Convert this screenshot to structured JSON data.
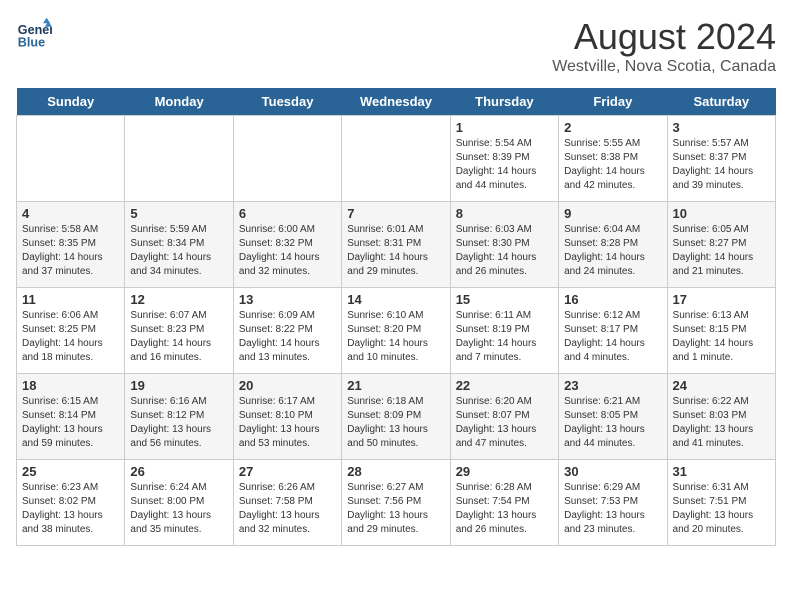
{
  "logo": {
    "line1": "General",
    "line2": "Blue"
  },
  "title": "August 2024",
  "subtitle": "Westville, Nova Scotia, Canada",
  "days_of_week": [
    "Sunday",
    "Monday",
    "Tuesday",
    "Wednesday",
    "Thursday",
    "Friday",
    "Saturday"
  ],
  "weeks": [
    [
      {
        "day": "",
        "info": ""
      },
      {
        "day": "",
        "info": ""
      },
      {
        "day": "",
        "info": ""
      },
      {
        "day": "",
        "info": ""
      },
      {
        "day": "1",
        "info": "Sunrise: 5:54 AM\nSunset: 8:39 PM\nDaylight: 14 hours and 44 minutes."
      },
      {
        "day": "2",
        "info": "Sunrise: 5:55 AM\nSunset: 8:38 PM\nDaylight: 14 hours and 42 minutes."
      },
      {
        "day": "3",
        "info": "Sunrise: 5:57 AM\nSunset: 8:37 PM\nDaylight: 14 hours and 39 minutes."
      }
    ],
    [
      {
        "day": "4",
        "info": "Sunrise: 5:58 AM\nSunset: 8:35 PM\nDaylight: 14 hours and 37 minutes."
      },
      {
        "day": "5",
        "info": "Sunrise: 5:59 AM\nSunset: 8:34 PM\nDaylight: 14 hours and 34 minutes."
      },
      {
        "day": "6",
        "info": "Sunrise: 6:00 AM\nSunset: 8:32 PM\nDaylight: 14 hours and 32 minutes."
      },
      {
        "day": "7",
        "info": "Sunrise: 6:01 AM\nSunset: 8:31 PM\nDaylight: 14 hours and 29 minutes."
      },
      {
        "day": "8",
        "info": "Sunrise: 6:03 AM\nSunset: 8:30 PM\nDaylight: 14 hours and 26 minutes."
      },
      {
        "day": "9",
        "info": "Sunrise: 6:04 AM\nSunset: 8:28 PM\nDaylight: 14 hours and 24 minutes."
      },
      {
        "day": "10",
        "info": "Sunrise: 6:05 AM\nSunset: 8:27 PM\nDaylight: 14 hours and 21 minutes."
      }
    ],
    [
      {
        "day": "11",
        "info": "Sunrise: 6:06 AM\nSunset: 8:25 PM\nDaylight: 14 hours and 18 minutes."
      },
      {
        "day": "12",
        "info": "Sunrise: 6:07 AM\nSunset: 8:23 PM\nDaylight: 14 hours and 16 minutes."
      },
      {
        "day": "13",
        "info": "Sunrise: 6:09 AM\nSunset: 8:22 PM\nDaylight: 14 hours and 13 minutes."
      },
      {
        "day": "14",
        "info": "Sunrise: 6:10 AM\nSunset: 8:20 PM\nDaylight: 14 hours and 10 minutes."
      },
      {
        "day": "15",
        "info": "Sunrise: 6:11 AM\nSunset: 8:19 PM\nDaylight: 14 hours and 7 minutes."
      },
      {
        "day": "16",
        "info": "Sunrise: 6:12 AM\nSunset: 8:17 PM\nDaylight: 14 hours and 4 minutes."
      },
      {
        "day": "17",
        "info": "Sunrise: 6:13 AM\nSunset: 8:15 PM\nDaylight: 14 hours and 1 minute."
      }
    ],
    [
      {
        "day": "18",
        "info": "Sunrise: 6:15 AM\nSunset: 8:14 PM\nDaylight: 13 hours and 59 minutes."
      },
      {
        "day": "19",
        "info": "Sunrise: 6:16 AM\nSunset: 8:12 PM\nDaylight: 13 hours and 56 minutes."
      },
      {
        "day": "20",
        "info": "Sunrise: 6:17 AM\nSunset: 8:10 PM\nDaylight: 13 hours and 53 minutes."
      },
      {
        "day": "21",
        "info": "Sunrise: 6:18 AM\nSunset: 8:09 PM\nDaylight: 13 hours and 50 minutes."
      },
      {
        "day": "22",
        "info": "Sunrise: 6:20 AM\nSunset: 8:07 PM\nDaylight: 13 hours and 47 minutes."
      },
      {
        "day": "23",
        "info": "Sunrise: 6:21 AM\nSunset: 8:05 PM\nDaylight: 13 hours and 44 minutes."
      },
      {
        "day": "24",
        "info": "Sunrise: 6:22 AM\nSunset: 8:03 PM\nDaylight: 13 hours and 41 minutes."
      }
    ],
    [
      {
        "day": "25",
        "info": "Sunrise: 6:23 AM\nSunset: 8:02 PM\nDaylight: 13 hours and 38 minutes."
      },
      {
        "day": "26",
        "info": "Sunrise: 6:24 AM\nSunset: 8:00 PM\nDaylight: 13 hours and 35 minutes."
      },
      {
        "day": "27",
        "info": "Sunrise: 6:26 AM\nSunset: 7:58 PM\nDaylight: 13 hours and 32 minutes."
      },
      {
        "day": "28",
        "info": "Sunrise: 6:27 AM\nSunset: 7:56 PM\nDaylight: 13 hours and 29 minutes."
      },
      {
        "day": "29",
        "info": "Sunrise: 6:28 AM\nSunset: 7:54 PM\nDaylight: 13 hours and 26 minutes."
      },
      {
        "day": "30",
        "info": "Sunrise: 6:29 AM\nSunset: 7:53 PM\nDaylight: 13 hours and 23 minutes."
      },
      {
        "day": "31",
        "info": "Sunrise: 6:31 AM\nSunset: 7:51 PM\nDaylight: 13 hours and 20 minutes."
      }
    ]
  ]
}
